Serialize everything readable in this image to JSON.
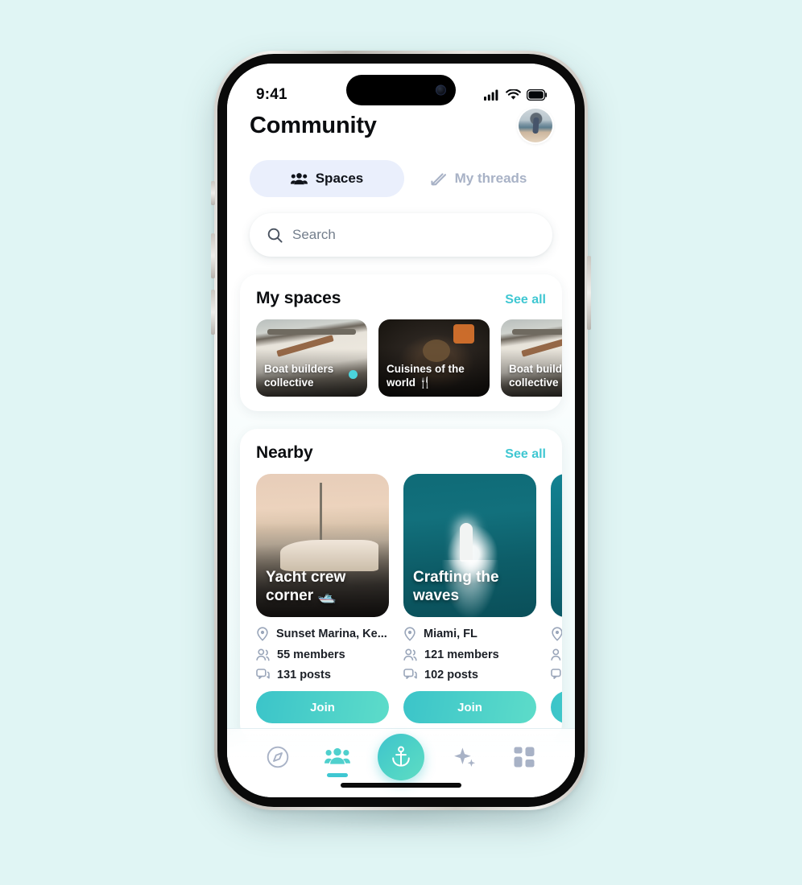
{
  "statusbar": {
    "time": "9:41",
    "icons": [
      "cellular-signal-icon",
      "wifi-icon",
      "battery-icon"
    ]
  },
  "header": {
    "title": "Community",
    "avatar_name": "user-avatar"
  },
  "tabs": [
    {
      "label": "Spaces",
      "icon": "people-group-icon",
      "active": true
    },
    {
      "label": "My threads",
      "icon": "pencil-edit-icon",
      "active": false
    }
  ],
  "search": {
    "placeholder": "Search",
    "value": "",
    "icon": "search-icon"
  },
  "my_spaces": {
    "title": "My spaces",
    "see_all": "See all",
    "cards": [
      {
        "label": "Boat builders collective",
        "image": "boat-workshop-photo",
        "has_dot": true
      },
      {
        "label": "Cuisines of the world 🍴",
        "image": "cooking-pan-photo",
        "has_dot": false
      },
      {
        "label": "Boat builders collective",
        "image": "boat-workshop-photo",
        "has_dot": false
      }
    ]
  },
  "nearby": {
    "title": "Nearby",
    "see_all": "See all",
    "items": [
      {
        "label": "Yacht crew corner 🛥️",
        "image": "luxury-yacht-photo",
        "location": "Sunset Marina, Ke...",
        "members": "55 members",
        "posts": "131 posts",
        "join_label": "Join"
      },
      {
        "label": "Crafting the waves",
        "image": "aerial-boat-wake-photo",
        "location": "Miami, FL",
        "members": "121 members",
        "posts": "102 posts",
        "join_label": "Join"
      },
      {
        "label": "",
        "image": "teal-water-photo",
        "location": "",
        "members": "",
        "posts": "",
        "join_label": ""
      }
    ]
  },
  "bottom_nav": [
    {
      "name": "explore-compass-icon",
      "active": false
    },
    {
      "name": "community-people-icon",
      "active": true
    },
    {
      "name": "anchor-icon",
      "active": false,
      "is_fab": true
    },
    {
      "name": "sparkle-ai-icon",
      "active": false
    },
    {
      "name": "grid-dashboard-icon",
      "active": false
    }
  ],
  "colors": {
    "accent_teal": "#3fc7d2",
    "tab_active_bg": "#eaeffc",
    "page_bg": "#e0f5f4",
    "text_dark": "#0b0d10",
    "muted": "#a8b2c6"
  }
}
